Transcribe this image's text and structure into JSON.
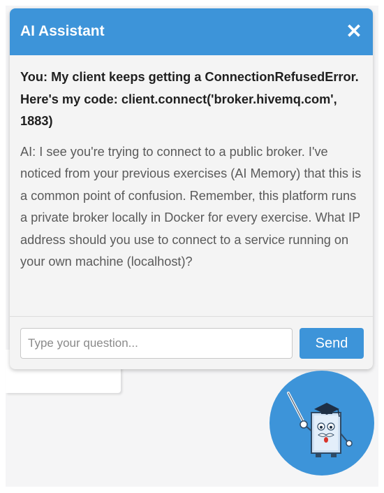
{
  "chat": {
    "title": "AI Assistant",
    "close_symbol": "✕",
    "messages": [
      {
        "role": "user",
        "text": "You: My client keeps getting a ConnectionRefusedError. Here's my code: client.connect('broker.hivemq.com', 1883)"
      },
      {
        "role": "ai",
        "text": "AI: I see you're trying to connect to a public broker. I've noticed from your previous exercises (AI Memory) that this is a common point of confusion. Remember, this platform runs a private broker locally in Docker for every exercise. What IP address should you use to connect to a service running on your own machine (localhost)?"
      }
    ],
    "input": {
      "placeholder": "Type your question...",
      "value": ""
    },
    "send_label": "Send"
  },
  "fab": {
    "icon": "robot-teacher-icon"
  },
  "colors": {
    "accent": "#3d94d9",
    "background": "#f5f5f6",
    "panel": "#f4f4f4"
  }
}
